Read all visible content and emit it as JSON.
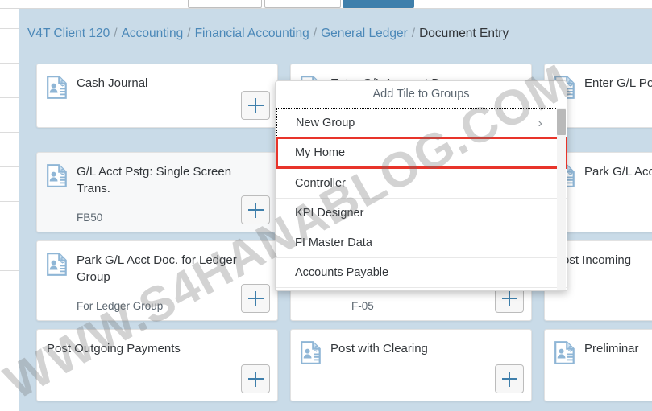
{
  "breadcrumb": {
    "items": [
      {
        "label": "V4T Client 120",
        "current": false
      },
      {
        "label": "Accounting",
        "current": false
      },
      {
        "label": "Financial Accounting",
        "current": false
      },
      {
        "label": "General Ledger",
        "current": false
      },
      {
        "label": "Document Entry",
        "current": true
      }
    ],
    "separator": "/"
  },
  "tiles": [
    {
      "title": "Cash Journal",
      "subtitle": "",
      "icon": "document-person-money-icon",
      "add_label": "+"
    },
    {
      "title": "Enter G/L Account Doc.",
      "subtitle": "",
      "icon": "document-person-money-icon",
      "add_label": "+"
    },
    {
      "title": "Enter G/L Posting",
      "subtitle": "",
      "icon": "document-person-money-icon",
      "add_label": "+"
    },
    {
      "title": "G/L Acct Pstg: Single Screen Trans.",
      "subtitle": "FB50",
      "icon": "document-person-money-icon",
      "add_label": "+"
    },
    {
      "title": "Park G/L Acct Items",
      "subtitle": "",
      "icon": "document-person-money-icon",
      "add_label": "+"
    },
    {
      "title": "Park G/L Acct Doc. for Ledger Group",
      "subtitle": "For Ledger Group",
      "icon": "document-person-money-icon",
      "add_label": "+"
    },
    {
      "title": "",
      "subtitle": "F-05",
      "icon": "",
      "add_label": "+"
    },
    {
      "title": "Post Incoming",
      "subtitle": "",
      "icon": "document-person-money-icon",
      "add_label": "+"
    },
    {
      "title": "Post Outgoing Payments",
      "subtitle": "",
      "icon": "",
      "add_label": "+"
    },
    {
      "title": "Post with Clearing",
      "subtitle": "",
      "icon": "document-person-money-icon",
      "add_label": "+"
    },
    {
      "title": "Preliminar",
      "subtitle": "",
      "icon": "document-person-money-icon",
      "add_label": "+"
    }
  ],
  "popup": {
    "title": "Add Tile to Groups",
    "items": [
      {
        "label": "New Group",
        "chevron": "›",
        "state": "focused"
      },
      {
        "label": "My Home",
        "chevron": "",
        "state": "highlighted"
      },
      {
        "label": "Controller",
        "chevron": "",
        "state": "normal"
      },
      {
        "label": "KPI Designer",
        "chevron": "",
        "state": "normal"
      },
      {
        "label": "FI Master Data",
        "chevron": "",
        "state": "normal"
      },
      {
        "label": "Accounts Payable",
        "chevron": "",
        "state": "normal"
      }
    ]
  },
  "watermark": {
    "text": "WWW.S4HANABLOG.COM"
  },
  "colors": {
    "page_background": "#c9dbe8",
    "link": "#4b88b8",
    "accent": "#3f7fab",
    "highlight_border": "#e8342a",
    "text": "#32363a"
  }
}
